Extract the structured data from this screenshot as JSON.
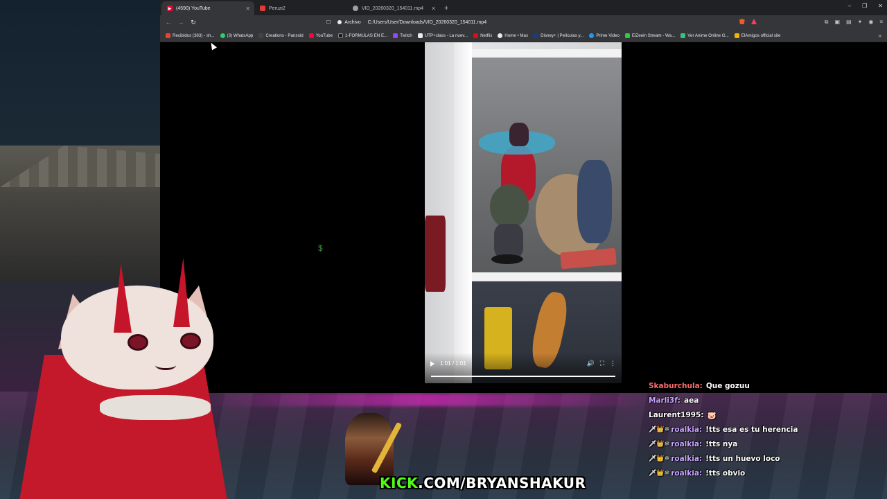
{
  "browser": {
    "tabs": [
      {
        "label": "(4590) YouTube",
        "favicon_color": "#ff0033",
        "active": true
      },
      {
        "label": "Peruzi2",
        "favicon_color": "#e03c31",
        "active": false
      },
      {
        "label": "VID_20260320_154011.mp4",
        "favicon_color": "#9aa0a6",
        "active": false
      }
    ],
    "new_tab": "+",
    "window_controls": {
      "minimize": "–",
      "restore": "❐",
      "close": "✕"
    },
    "nav": {
      "back": "←",
      "forward": "→",
      "reload": "↻"
    },
    "address": {
      "chip": "Archivo",
      "url": "C:/Users/User/Downloads/VID_20260320_154011.mp4"
    },
    "bookmarks": [
      {
        "label": "Recibidos (383) - sh...",
        "color": "#ea4335"
      },
      {
        "label": "(3) WhatsApp",
        "color": "#25d366"
      },
      {
        "label": "Creations - Panzoid",
        "color": "#444444"
      },
      {
        "label": "YouTube",
        "color": "#ff0033"
      },
      {
        "label": "1-FORMULAS EN E...",
        "color": "#1a1a1a"
      },
      {
        "label": "Twitch",
        "color": "#9146ff"
      },
      {
        "label": "UTP+class - La nuev...",
        "color": "#e8eaed"
      },
      {
        "label": "Netflix",
        "color": "#e50914"
      },
      {
        "label": "Home • Max",
        "color": "#e8eaed"
      },
      {
        "label": "Disney+ | Películas y...",
        "color": "#1a3a8a"
      },
      {
        "label": "Prime Video",
        "color": "#1f9bf0"
      },
      {
        "label": "ElZeein Stream - Wa...",
        "color": "#2ecc40"
      },
      {
        "label": "Ver Anime Online G...",
        "color": "#37c37c"
      },
      {
        "label": "ElAmigos official site",
        "color": "#f5b301"
      }
    ],
    "bookmarks_more": "»"
  },
  "video": {
    "time": "1:01 / 1:01",
    "progress_fraction": 1.0
  },
  "overlay": {
    "kick_prefix": "KICK",
    "kick_suffix": ".COM/BRYANSHAKUR"
  },
  "chat": [
    {
      "user": "Skaburchula:",
      "user_color": "#ff6b6b",
      "badges": "",
      "message": "Que gozuu"
    },
    {
      "user": "Marli3f:",
      "user_color": "#c9a6ff",
      "badges": "",
      "message": "aea"
    },
    {
      "user": "Laurent1995:",
      "user_color": "#ffffff",
      "badges": "",
      "message": "🐷"
    },
    {
      "user": "roalkia:",
      "user_color": "#c9a6ff",
      "badges": "🗡👑❄",
      "message": "!tts esa es tu herencia"
    },
    {
      "user": "roalkia:",
      "user_color": "#c9a6ff",
      "badges": "🗡👑❄",
      "message": "!tts nya"
    },
    {
      "user": "roalkia:",
      "user_color": "#c9a6ff",
      "badges": "🗡👑❄",
      "message": "!tts un huevo loco"
    },
    {
      "user": "roalkia:",
      "user_color": "#c9a6ff",
      "badges": "🗡👑❄",
      "message": "!tts obvio"
    }
  ]
}
